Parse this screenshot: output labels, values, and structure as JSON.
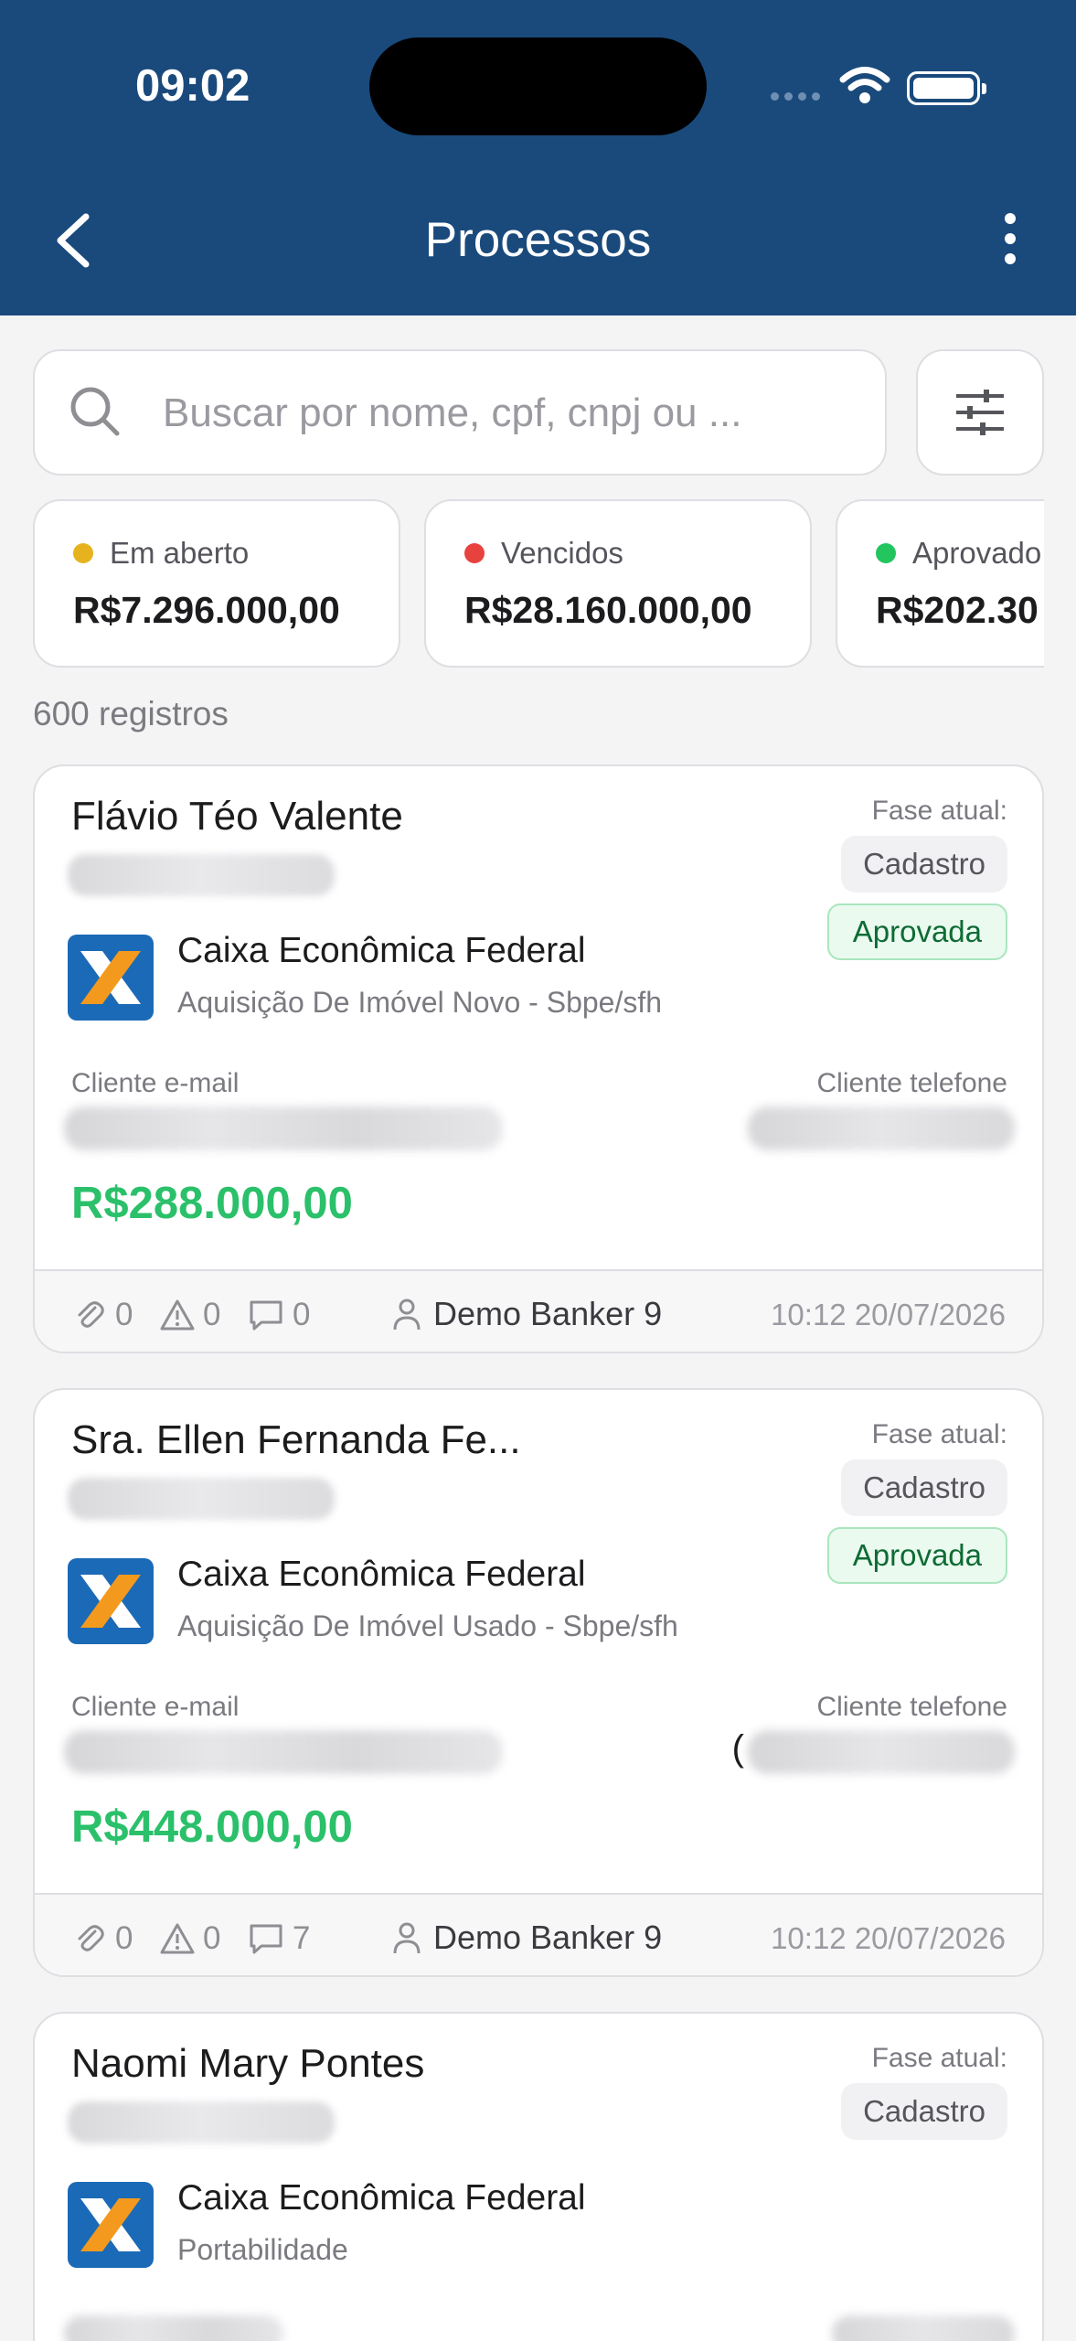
{
  "status_bar": {
    "time": "09:02"
  },
  "header": {
    "title": "Processos"
  },
  "search": {
    "placeholder": "Buscar por nome, cpf, cnpj ou ..."
  },
  "colors": {
    "header_bg": "#1a4a7c",
    "accent_green": "#2bc06a",
    "dot_open": "#e6b31e",
    "dot_overdue": "#e8423f",
    "dot_approved": "#22c55e"
  },
  "summary": [
    {
      "label": "Em aberto",
      "value": "R$7.296.000,00"
    },
    {
      "label": "Vencidos",
      "value": "R$28.160.000,00"
    },
    {
      "label": "Aprovado",
      "value": "R$202.30"
    }
  ],
  "records_count": "600 registros",
  "cards": [
    {
      "name": "Flávio Téo Valente",
      "phase_label": "Fase atual:",
      "phase": "Cadastro",
      "status": "Aprovada",
      "bank": "Caixa Econômica Federal",
      "product": "Aquisição De Imóvel Novo - Sbpe/sfh",
      "email_label": "Cliente e-mail",
      "phone_label": "Cliente telefone",
      "amount": "R$288.000,00",
      "attachments": "0",
      "alerts": "0",
      "comments": "0",
      "banker": "Demo Banker 9",
      "datetime": "10:12 20/07/2026"
    },
    {
      "name": "Sra. Ellen Fernanda Fe...",
      "phase_label": "Fase atual:",
      "phase": "Cadastro",
      "status": "Aprovada",
      "bank": "Caixa Econômica Federal",
      "product": "Aquisição De Imóvel Usado - Sbpe/sfh",
      "email_label": "Cliente e-mail",
      "phone_label": "Cliente telefone",
      "phone_prefix": "(",
      "amount": "R$448.000,00",
      "attachments": "0",
      "alerts": "0",
      "comments": "7",
      "banker": "Demo Banker 9",
      "datetime": "10:12 20/07/2026"
    },
    {
      "name": "Naomi Mary Pontes",
      "phase_label": "Fase atual:",
      "phase": "Cadastro",
      "bank": "Caixa Econômica Federal",
      "product": "Portabilidade"
    }
  ]
}
